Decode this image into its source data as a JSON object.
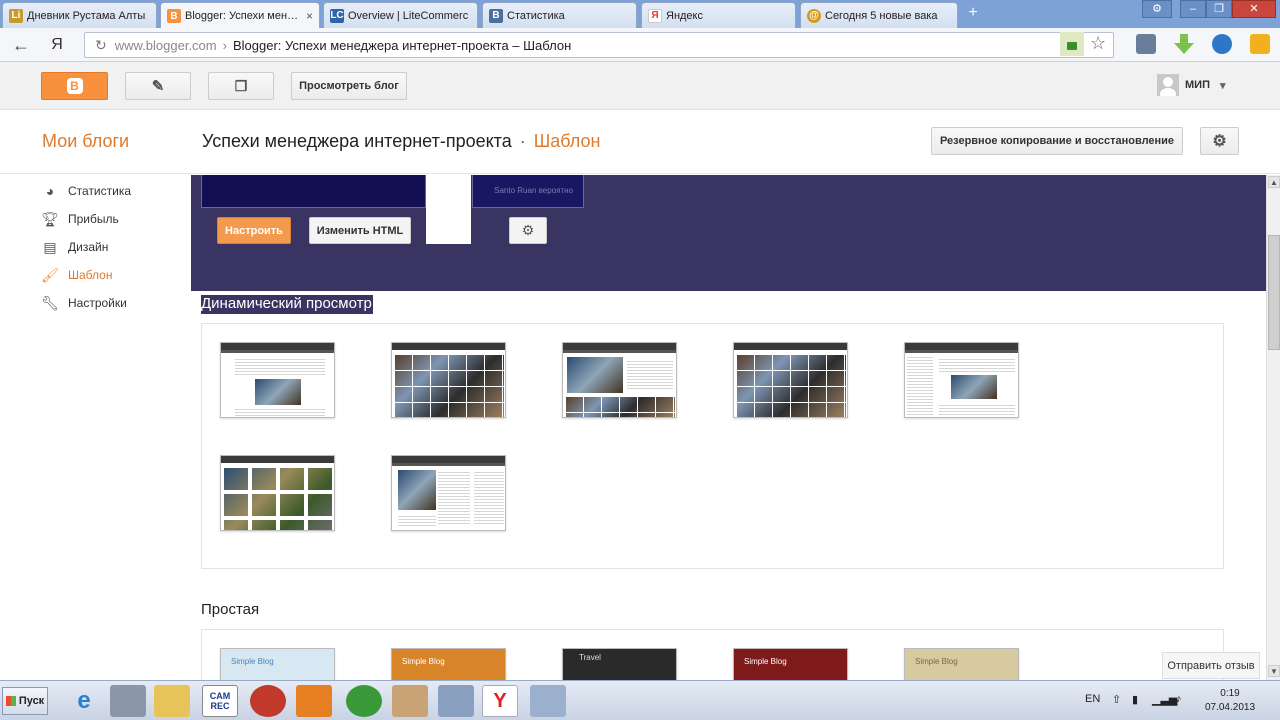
{
  "browser": {
    "tabs": [
      {
        "label": "Дневник Рустама Алты",
        "favicon": "LiveInternet",
        "color": "#c79a2c"
      },
      {
        "label": "Blogger: Успехи менедж",
        "favicon": "blogger",
        "color": "#f7913d",
        "active": true
      },
      {
        "label": "Overview | LiteCommerc",
        "favicon": "LC",
        "color": "#2f65a8"
      },
      {
        "label": "Статистика",
        "favicon": "В",
        "color": "#4c6f9e"
      },
      {
        "label": "Яндекс",
        "favicon": "Я",
        "color": "#e33"
      },
      {
        "label": "Сегодня 5 новые вака",
        "favicon": "@",
        "color": "#d59a1c"
      }
    ],
    "tab_close": "×",
    "new_tab": "+",
    "url_host": "www.blogger.com",
    "url_sep": "›",
    "url_path": "Blogger: Успехи менеджера интернет-проекта – Шаблон",
    "yandex_btn": "Я"
  },
  "blogger_bar": {
    "view_blog": "Просмотреть блог",
    "user_name": "МИП",
    "user_caret": "▾"
  },
  "header": {
    "my_blogs": "Мои блоги",
    "blog_name": "Успехи менеджера интернет-проекта",
    "dot": "·",
    "section": "Шаблон",
    "backup_button": "Резервное копирование и восстановление"
  },
  "sidebar": {
    "items": [
      {
        "label": "Статистика",
        "icon": "pie-chart-icon"
      },
      {
        "label": "Прибыль",
        "icon": "trophy-icon"
      },
      {
        "label": "Дизайн",
        "icon": "layout-icon"
      },
      {
        "label": "Шаблон",
        "icon": "paint-roller-icon",
        "active": true
      },
      {
        "label": "Настройки",
        "icon": "wrench-icon"
      }
    ]
  },
  "template": {
    "preview_text": "Santo Ruan вероятно",
    "customize_button": "Настроить",
    "edit_html_button": "Изменить HTML",
    "dynamic_title": "Динамический просмотр",
    "simple_title": "Простая",
    "simple_thumbs": [
      {
        "label": "Simple Blog",
        "color": "#d8e8f2",
        "text": "#4a84b8"
      },
      {
        "label": "Simple Blog",
        "color": "#d8852a",
        "text": "#fff"
      },
      {
        "label": "Travel",
        "color": "#2a2a2a",
        "text": "#ddd"
      },
      {
        "label": "Simple Blog",
        "color": "#7e1a1a",
        "text": "#fff"
      },
      {
        "label": "Simple Blog",
        "color": "#d8caa0",
        "text": "#7a6a40"
      }
    ]
  },
  "feedback_button": "Отправить отзыв",
  "taskbar": {
    "start_label": "Пуск",
    "camrec": "CAM REC",
    "lang": "EN",
    "time": "0:19",
    "date": "07.04.2013"
  },
  "colors": {
    "accent": "#f7913d",
    "banner": "#3a3462"
  }
}
